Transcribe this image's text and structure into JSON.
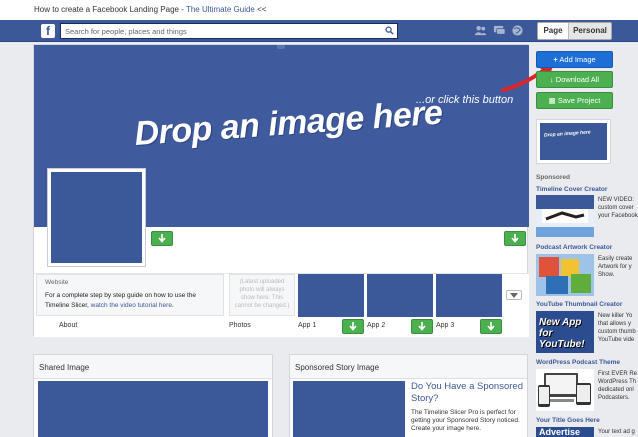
{
  "title_bar": {
    "prefix": "How to create a Facebook Landing Page - ",
    "link": "The Ultimate Guide",
    "suffix": " <<"
  },
  "fb_bar": {
    "logo": "f",
    "search_placeholder": "Search for people, places and things",
    "icons": [
      "friends-icon",
      "messages-icon",
      "globe-icon"
    ],
    "toggle": {
      "page": "Page",
      "personal": "Personal",
      "selected": "Page"
    }
  },
  "cover": {
    "hint": "...or click this button",
    "main": "Drop an image here"
  },
  "info": {
    "website_title": "Website",
    "website_text": "For a complete step by step guide on how to use the Timeline Slicer, ",
    "website_link": "watch the video tutorial here",
    "website_end": ".",
    "placeholder_text": "(Latest uploaded photo will always show here. This cannot be changed.)",
    "tabs": [
      "About",
      "Photos",
      "App 1",
      "App 2",
      "App 3"
    ]
  },
  "panels": {
    "shared": {
      "title": "Shared Image"
    },
    "sponsored": {
      "title": "Sponsored Story Image",
      "headline": "Do You Have a Sponsored Story?",
      "desc": "The Timeline Slicer Pro is perfect for getting your Sponsored Story noticed. Create your image here."
    }
  },
  "sidebar": {
    "add_image": "Add Image",
    "download_all": "Download All",
    "save_project": "Save Project",
    "preview_text": "Drop an image here",
    "sponsored_label": "Sponsored",
    "ads": [
      {
        "title": "Timeline Cover Creator",
        "lines": [
          "NEW VIDEO:",
          "custom cover",
          "your Facebook"
        ]
      },
      {
        "title": "Podcast Artwork Creator",
        "lines": [
          "Easily create",
          "Artwork for y",
          "Show."
        ]
      },
      {
        "title": "YouTube Thumbnail Creator",
        "lines": [
          "New killer Yo",
          "that allows y",
          "custom thumb",
          "YouTube vide"
        ],
        "image_text": "New App for YouTube!"
      },
      {
        "title": "WordPress Podcast Theme",
        "lines": [
          "First EVER Re",
          "WordPress Th",
          "dedicated onl",
          "Podcasters."
        ]
      },
      {
        "title": "Your Title Goes Here",
        "lines": [
          "Your text ad g"
        ],
        "image_text": "Advertise"
      }
    ]
  },
  "colors": {
    "facebook_blue": "#3b5998",
    "cover_blue": "#3f5b9e",
    "green": "#4caf50",
    "add_blue": "#1d6fd6"
  }
}
